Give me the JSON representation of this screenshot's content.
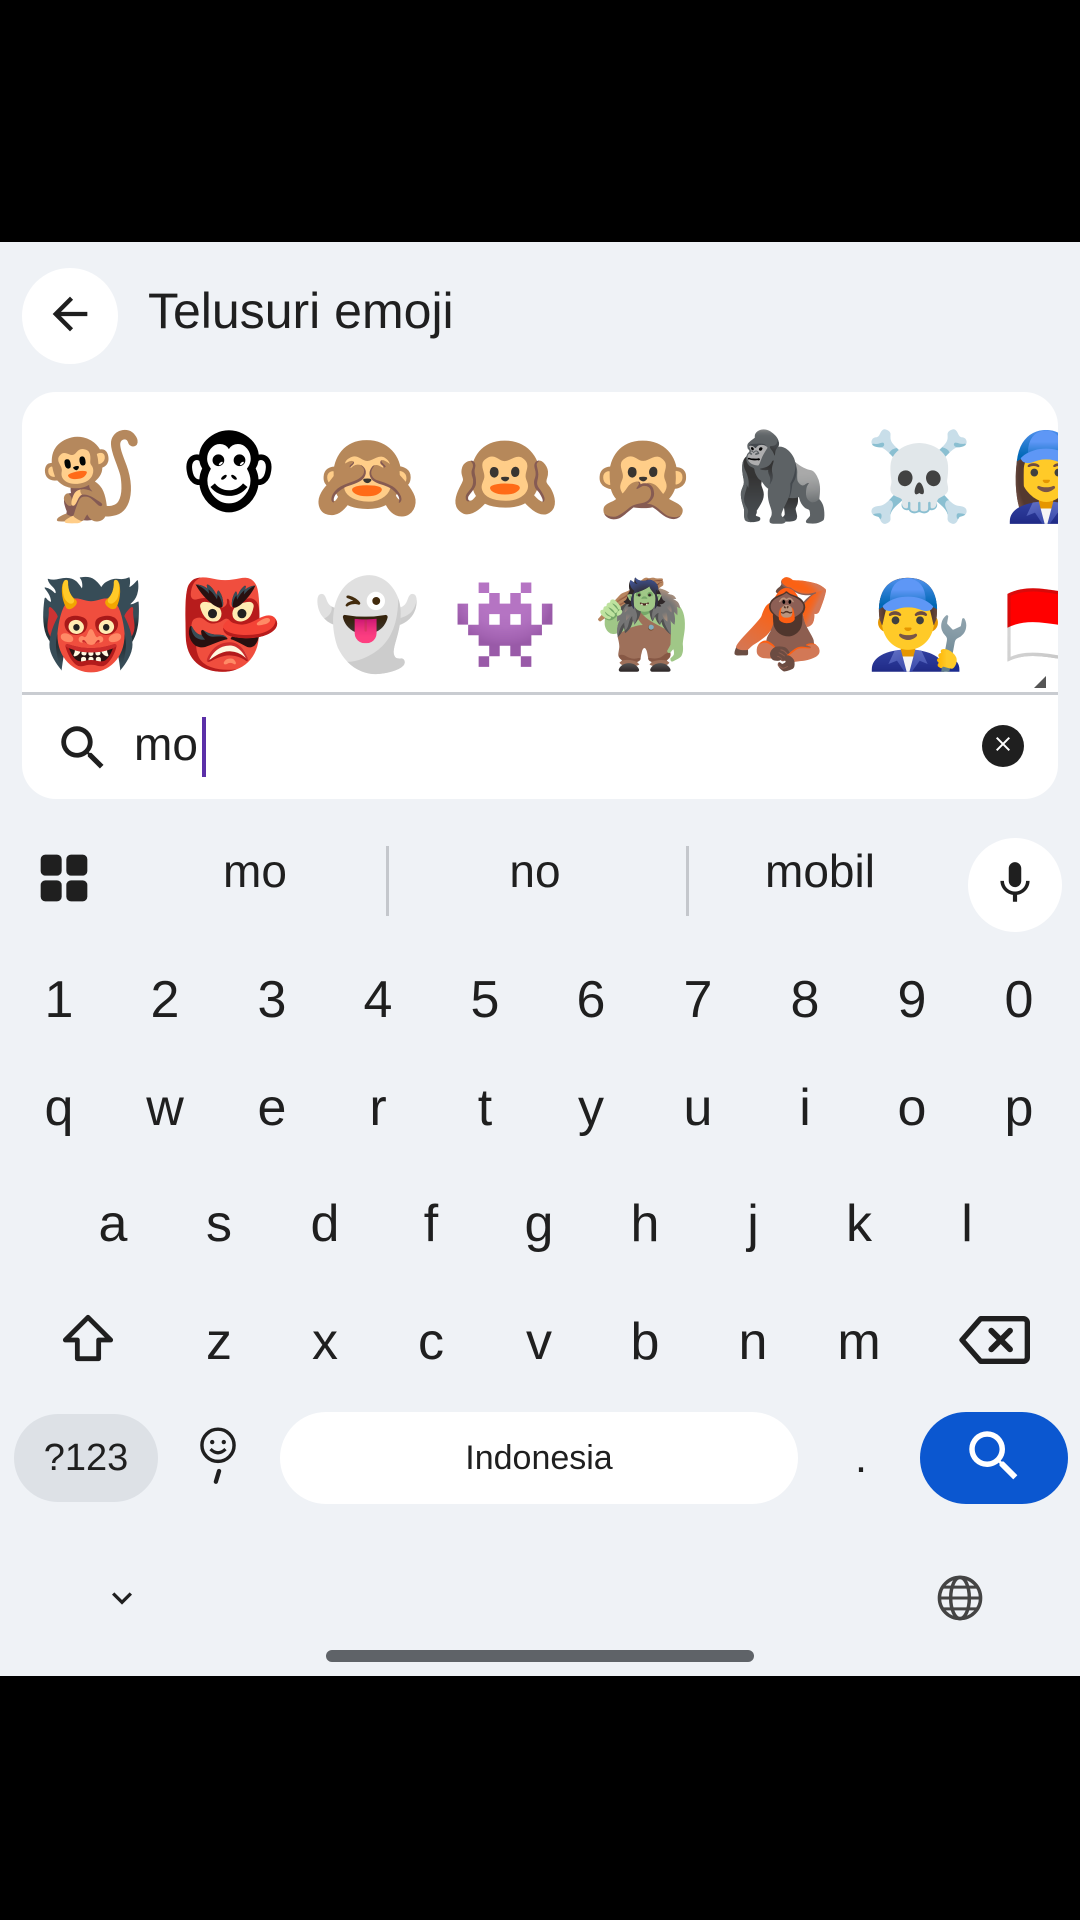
{
  "header": {
    "title": "Telusuri emoji",
    "back_icon": "arrow-left-icon"
  },
  "emoji_results": {
    "row1": [
      "🐒",
      "🐵",
      "🙈",
      "🙉",
      "🙊",
      "🦍",
      "☠️",
      "👩‍🔧"
    ],
    "row2": [
      "👹",
      "👺",
      "👻",
      "👾",
      "🧌",
      "🦧",
      "👨‍🔧",
      "🇮🇩"
    ]
  },
  "search": {
    "value": "mo",
    "search_icon": "search-icon",
    "clear_icon": "close-circle-icon"
  },
  "suggestions": {
    "items": [
      "mo",
      "no",
      "mobil"
    ],
    "grid_icon": "grid-icon",
    "mic_icon": "microphone-icon"
  },
  "keyboard": {
    "number_row": [
      "1",
      "2",
      "3",
      "4",
      "5",
      "6",
      "7",
      "8",
      "9",
      "0"
    ],
    "row1": [
      "q",
      "w",
      "e",
      "r",
      "t",
      "y",
      "u",
      "i",
      "o",
      "p"
    ],
    "row2": [
      "a",
      "s",
      "d",
      "f",
      "g",
      "h",
      "j",
      "k",
      "l"
    ],
    "row3": [
      "z",
      "x",
      "c",
      "v",
      "b",
      "n",
      "m"
    ],
    "symbols_label": "?123",
    "space_label": "Indonesia",
    "period_label": ".",
    "shift_icon": "shift-icon",
    "backspace_icon": "backspace-icon",
    "emoji_icon": "emoji-icon",
    "search_action_icon": "search-icon",
    "hide_icon": "chevron-down-icon",
    "language_icon": "globe-icon"
  },
  "colors": {
    "accent": "#0b57d0",
    "background": "#eff2f6",
    "symbols_key": "#dde1e6"
  }
}
